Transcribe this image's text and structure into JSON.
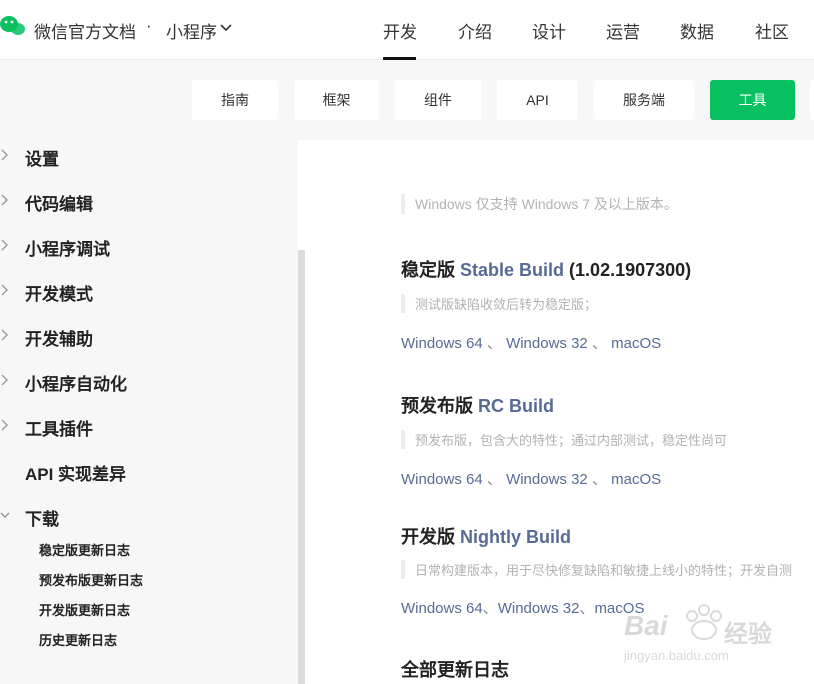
{
  "header": {
    "site_title": "微信官方文档",
    "separator": "·",
    "product": "小程序",
    "nav": [
      "开发",
      "介绍",
      "设计",
      "运营",
      "数据",
      "社区"
    ]
  },
  "subnav": {
    "tabs": [
      "指南",
      "框架",
      "组件",
      "API",
      "服务端",
      "工具"
    ],
    "active": "工具"
  },
  "sidebar": {
    "items": [
      "设置",
      "代码编辑",
      "小程序调试",
      "开发模式",
      "开发辅助",
      "小程序自动化",
      "工具插件",
      "API 实现差异",
      "下载"
    ],
    "sub_items": [
      "稳定版更新日志",
      "预发布版更新日志",
      "开发版更新日志",
      "历史更新日志"
    ]
  },
  "content": {
    "note_windows": "Windows 仅支持 Windows 7 及以上版本。",
    "stable": {
      "title_cn": "稳定版",
      "title_en": "Stable Build",
      "version": "(1.02.1907300)",
      "note": "测试版缺陷收敛后转为稳定版；",
      "links": [
        "Windows 64",
        "Windows 32",
        "macOS"
      ]
    },
    "rc": {
      "title_cn": "预发布版",
      "title_en": "RC Build",
      "note": "预发布版，包含大的特性；通过内部测试，稳定性尚可",
      "links": [
        "Windows 64",
        "Windows 32",
        "macOS"
      ]
    },
    "nightly": {
      "title_cn": "开发版",
      "title_en": "Nightly Build",
      "note": "日常构建版本，用于尽快修复缺陷和敏捷上线小的特性；开发自测",
      "links": [
        "Windows 64",
        "Windows 32",
        "macOS"
      ]
    },
    "changelog_title": "全部更新日志",
    "link_sep": "、"
  },
  "watermark": {
    "brand": "Bai",
    "brand_suffix": "经验",
    "url": "jingyan.baidu.com"
  },
  "colors": {
    "accent": "#07c160",
    "link": "#576b95"
  }
}
